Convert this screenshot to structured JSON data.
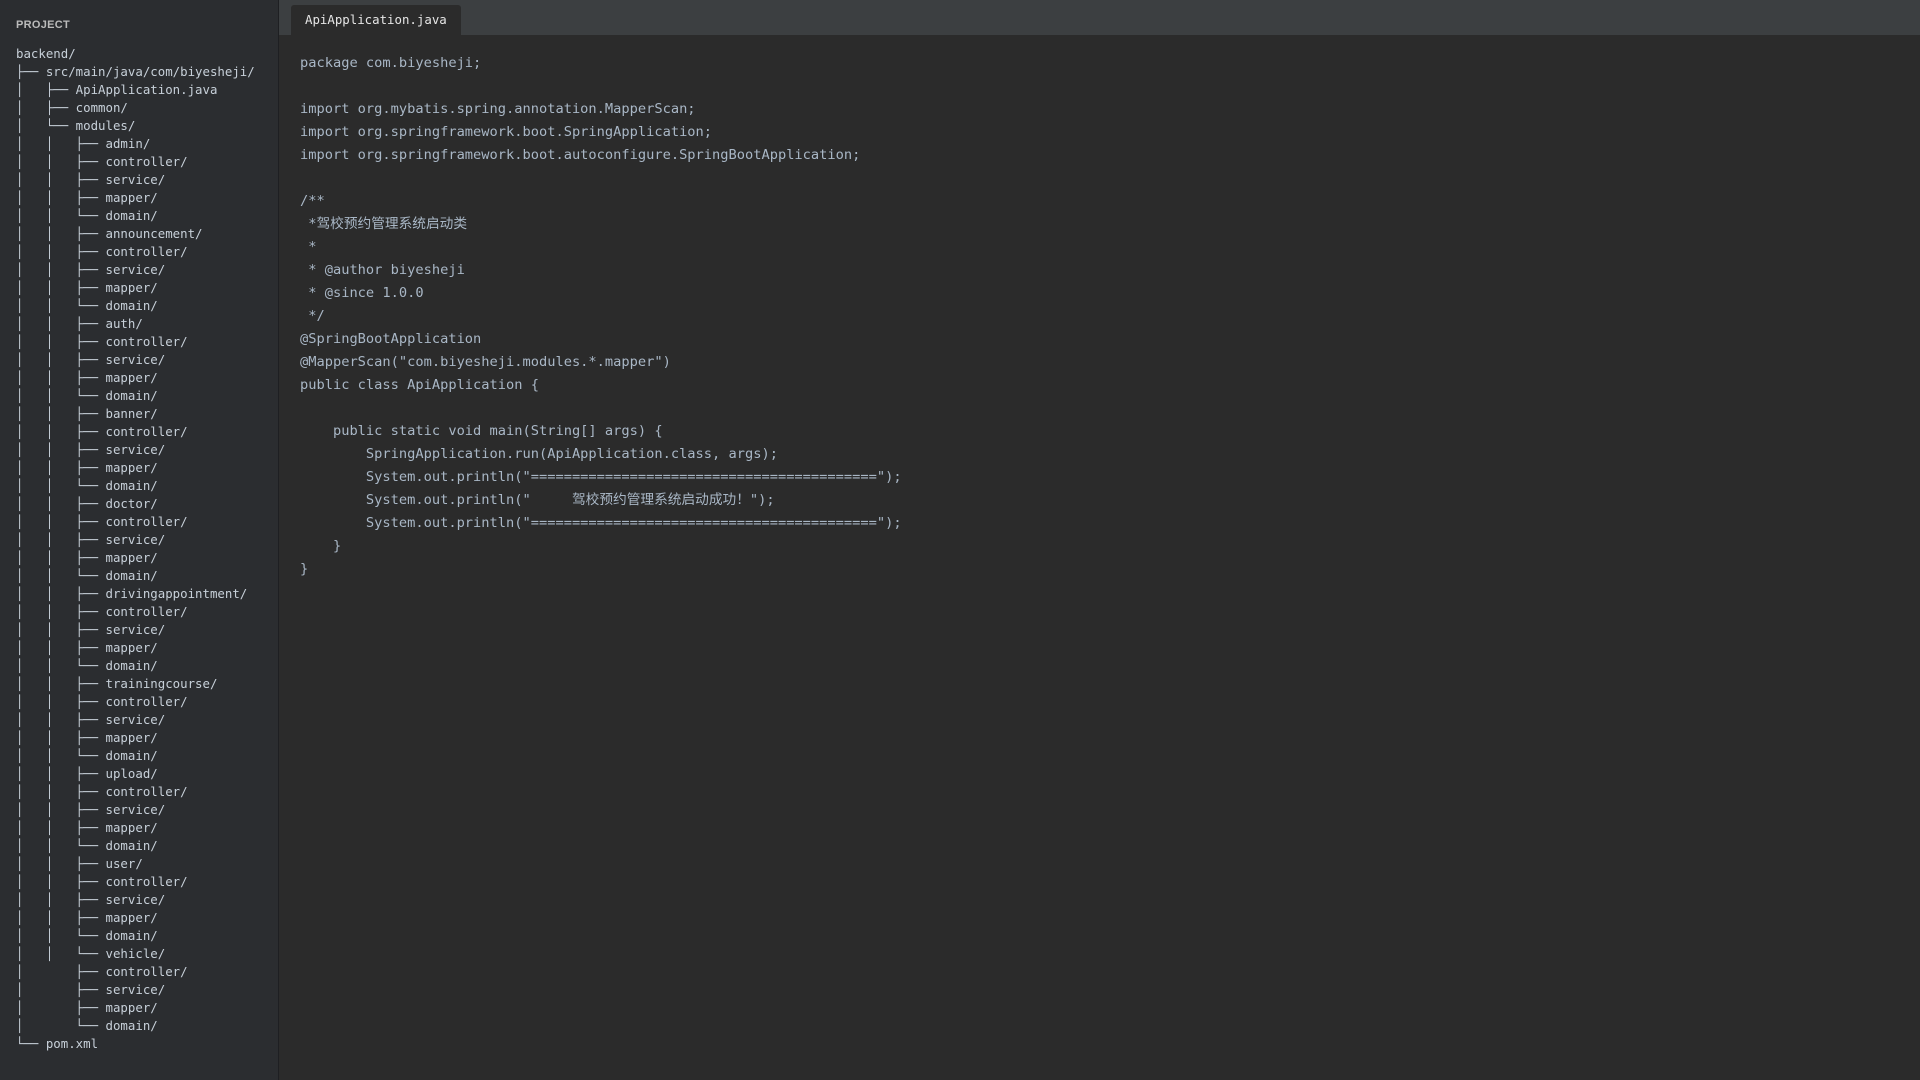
{
  "sidebar": {
    "title": "PROJECT",
    "tree": [
      "backend/",
      "├── src/main/java/com/biyesheji/",
      "│   ├── ApiApplication.java",
      "│   ├── common/",
      "│   └── modules/",
      "│   │   ├── admin/",
      "│   │   ├── controller/",
      "│   │   ├── service/",
      "│   │   ├── mapper/",
      "│   │   └── domain/",
      "│   │   ├── announcement/",
      "│   │   ├── controller/",
      "│   │   ├── service/",
      "│   │   ├── mapper/",
      "│   │   └── domain/",
      "│   │   ├── auth/",
      "│   │   ├── controller/",
      "│   │   ├── service/",
      "│   │   ├── mapper/",
      "│   │   └── domain/",
      "│   │   ├── banner/",
      "│   │   ├── controller/",
      "│   │   ├── service/",
      "│   │   ├── mapper/",
      "│   │   └── domain/",
      "│   │   ├── doctor/",
      "│   │   ├── controller/",
      "│   │   ├── service/",
      "│   │   ├── mapper/",
      "│   │   └── domain/",
      "│   │   ├── drivingappointment/",
      "│   │   ├── controller/",
      "│   │   ├── service/",
      "│   │   ├── mapper/",
      "│   │   └── domain/",
      "│   │   ├── trainingcourse/",
      "│   │   ├── controller/",
      "│   │   ├── service/",
      "│   │   ├── mapper/",
      "│   │   └── domain/",
      "│   │   ├── upload/",
      "│   │   ├── controller/",
      "│   │   ├── service/",
      "│   │   ├── mapper/",
      "│   │   └── domain/",
      "│   │   ├── user/",
      "│   │   ├── controller/",
      "│   │   ├── service/",
      "│   │   ├── mapper/",
      "│   │   └── domain/",
      "│   │   └── vehicle/",
      "│       ├── controller/",
      "│       ├── service/",
      "│       ├── mapper/",
      "│       └── domain/",
      "└── pom.xml"
    ]
  },
  "tabs": [
    {
      "label": "ApiApplication.java",
      "active": true
    }
  ],
  "code_lines": [
    "package com.biyesheji;",
    "",
    "import org.mybatis.spring.annotation.MapperScan;",
    "import org.springframework.boot.SpringApplication;",
    "import org.springframework.boot.autoconfigure.SpringBootApplication;",
    "",
    "/**",
    " *驾校预约管理系统启动类",
    " *",
    " * @author biyesheji",
    " * @since 1.0.0",
    " */",
    "@SpringBootApplication",
    "@MapperScan(\"com.biyesheji.modules.*.mapper\")",
    "public class ApiApplication {",
    "",
    "    public static void main(String[] args) {",
    "        SpringApplication.run(ApiApplication.class, args);",
    "        System.out.println(\"==========================================\");",
    "        System.out.println(\"     驾校预约管理系统启动成功！\");",
    "        System.out.println(\"==========================================\");",
    "    }",
    "}"
  ],
  "colors": {
    "editor_bg": "#2b2b2b",
    "sidebar_bg": "#2b2d30",
    "tabbar_bg": "#3c3f41",
    "text": "#a9b7c6"
  }
}
